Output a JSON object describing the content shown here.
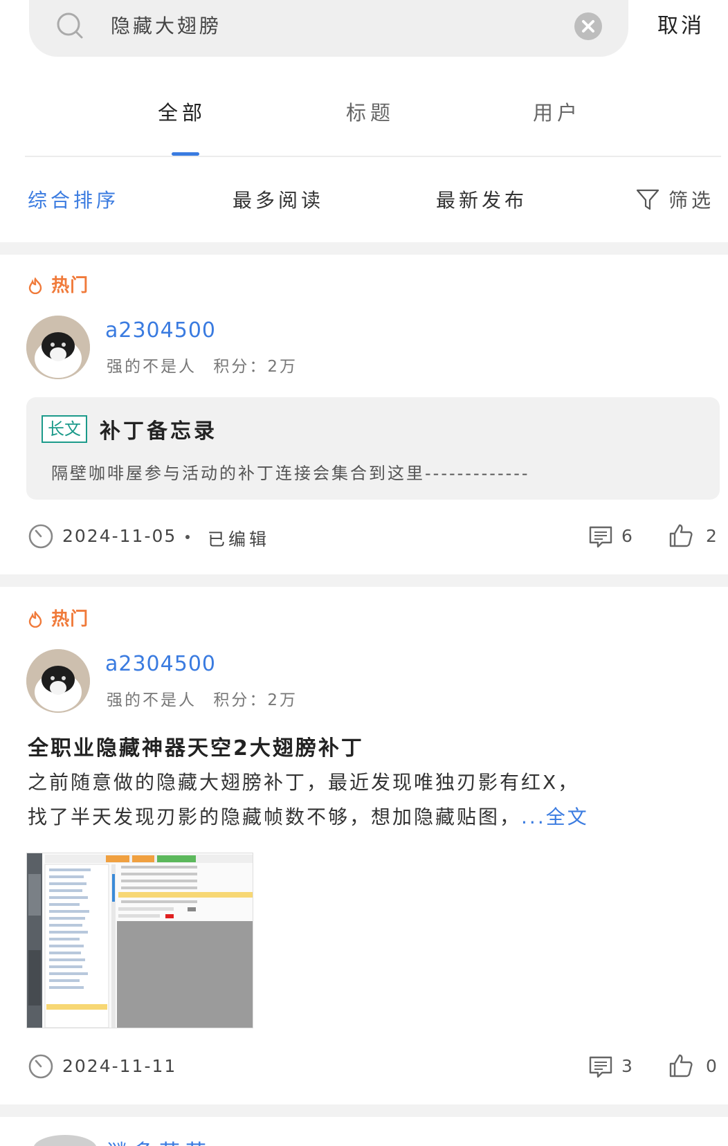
{
  "search": {
    "query": "隐藏大翅膀",
    "cancel_label": "取消"
  },
  "tabs": [
    {
      "label": "全部",
      "active": true
    },
    {
      "label": "标题",
      "active": false
    },
    {
      "label": "用户",
      "active": false
    }
  ],
  "sort": {
    "options": [
      "综合排序",
      "最多阅读",
      "最新发布"
    ],
    "active": "综合排序",
    "filter_label": "筛选"
  },
  "colors": {
    "accent": "#3a7be0",
    "hot": "#f07a3a",
    "badge": "#1b9a8a"
  },
  "posts": [
    {
      "hot_label": "热门",
      "username": "a2304500",
      "user_title": "强的不是人",
      "points": "积分：2万",
      "badge": "长文",
      "title": "补丁备忘录",
      "summary": "隔壁咖啡屋参与活动的补丁连接会集合到这里-------------",
      "date": "2024-11-05",
      "edited_label": "已编辑",
      "comments": "6",
      "likes": "2"
    },
    {
      "hot_label": "热门",
      "username": "a2304500",
      "user_title": "强的不是人",
      "points": "积分：2万",
      "title": "全职业隐藏神器天空2大翅膀补丁",
      "body_line1": "之前随意做的隐藏大翅膀补丁，最近发现唯独刃影有红X，",
      "body_line2": "找了半天发现刃影的隐藏帧数不够，想加隐藏贴图，",
      "more_label": "...全文",
      "date": "2024-11-11",
      "comments": "3",
      "likes": "0"
    }
  ],
  "next_post": {
    "username_partial": "谜多芙芙"
  }
}
